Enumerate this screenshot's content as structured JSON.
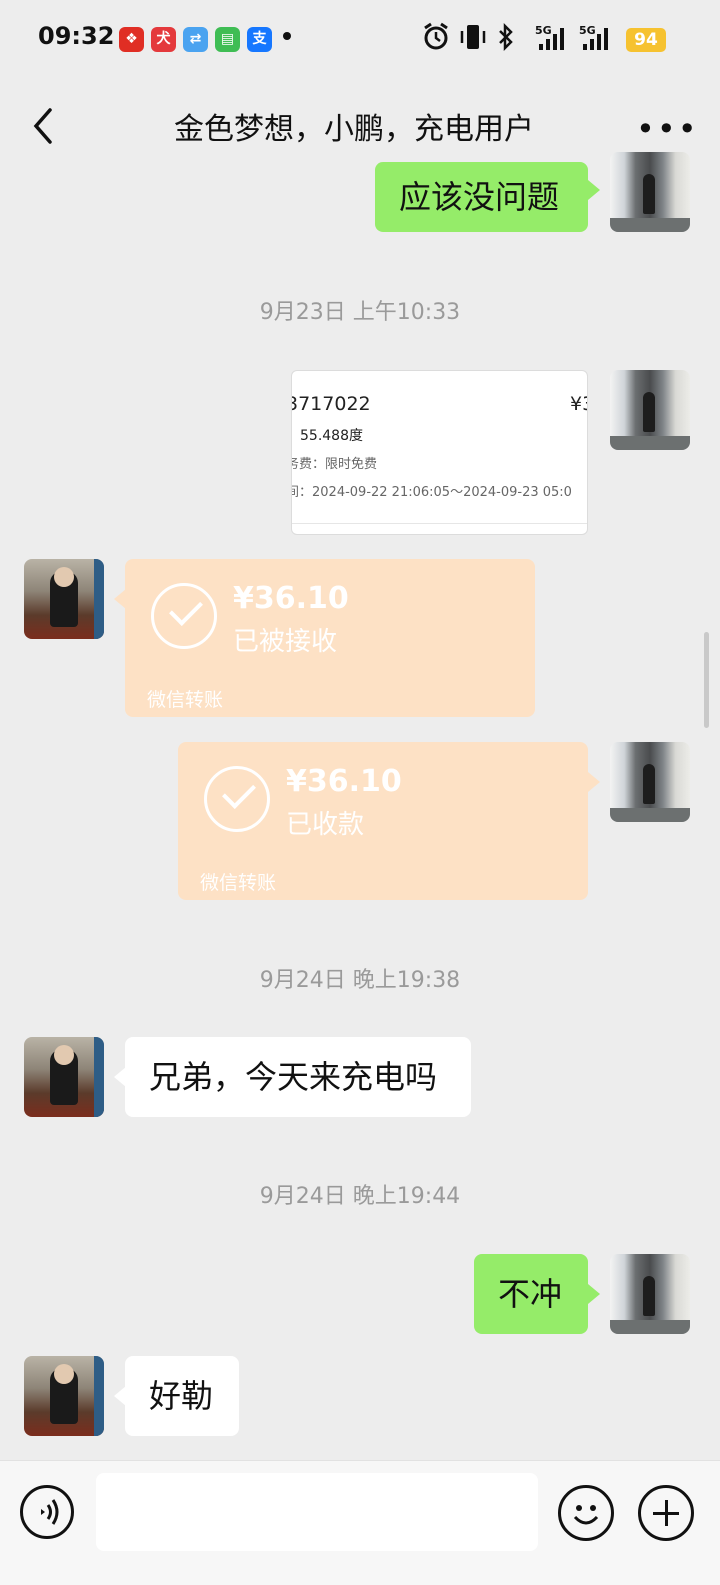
{
  "status_bar": {
    "time": "09:32",
    "app_icons": [
      {
        "name": "pinduoduo-icon",
        "color": "#e02e24",
        "glyph": "❖"
      },
      {
        "name": "jd-icon",
        "color": "#e4393c",
        "glyph": "犬"
      },
      {
        "name": "taobao-special-icon",
        "color": "#4aa3f0",
        "glyph": "⇄"
      },
      {
        "name": "messages-icon",
        "color": "#3fbd54",
        "glyph": "▤"
      },
      {
        "name": "alipay-icon",
        "color": "#1677ff",
        "glyph": "支"
      }
    ],
    "network": [
      "5G",
      "5G"
    ],
    "battery": "94"
  },
  "nav": {
    "title": "金色梦想，小鹏，充电用户",
    "more": "•••"
  },
  "messages": {
    "m1": {
      "sender": "me",
      "text": "应该没问题"
    },
    "ts1": "9月23日 上午10:33",
    "receipt": {
      "order": "3717022",
      "price": "¥3",
      "energy": "：55.488度",
      "fee": "务费：限时免费",
      "time": "间：2024-09-22 21:06:05～2024-09-23 05:0"
    },
    "transfer_friend": {
      "amount": "¥36.10",
      "status": "已被接收",
      "label": "微信转账"
    },
    "transfer_me": {
      "amount": "¥36.10",
      "status": "已收款",
      "label": "微信转账"
    },
    "ts2": "9月24日 晚上19:38",
    "m2": {
      "sender": "friend",
      "text": "兄弟，今天来充电吗"
    },
    "ts3": "9月24日 晚上19:44",
    "m3": {
      "sender": "me",
      "text": "不冲"
    },
    "m4": {
      "sender": "friend",
      "text": "好勒"
    }
  },
  "input": {
    "placeholder": ""
  }
}
